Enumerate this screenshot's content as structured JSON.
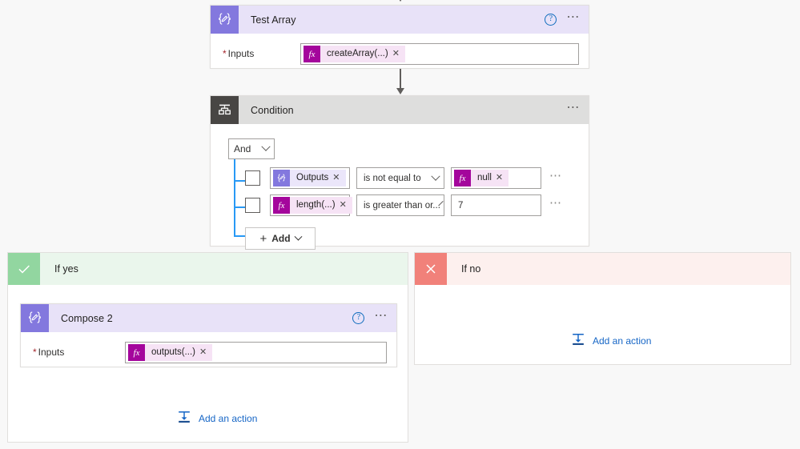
{
  "flow": {
    "compose_top": {
      "title": "Test Array",
      "icon": "compose-braces-icon",
      "help_icon": "help-circle-icon",
      "more_icon": "more-options-icon",
      "field_label": "Inputs",
      "required_marker": "*",
      "token": {
        "badge": "fx",
        "badge_icon": "function-fx-icon",
        "text": "createArray(...)",
        "remove_icon": "remove-token-icon",
        "remove_glyph": "✕"
      }
    },
    "condition": {
      "title": "Condition",
      "icon": "condition-branch-icon",
      "more_icon": "more-options-icon",
      "logical_operator": "And",
      "logical_operator_chevron": "chevron-down-icon",
      "rows": [
        {
          "checkbox_checked": false,
          "operand": {
            "badge_icon": "compose-braces-icon",
            "badge": "{⊘}",
            "text": "Outputs",
            "remove_glyph": "✕",
            "style": "compose"
          },
          "operator": "is not equal to",
          "operator_chevron": "chevron-down-icon",
          "value_token": {
            "badge": "fx",
            "badge_icon": "function-fx-icon",
            "text": "null",
            "remove_glyph": "✕",
            "style": "fx"
          },
          "value_text": "",
          "more_icon": "row-more-options-icon"
        },
        {
          "checkbox_checked": false,
          "operand": {
            "badge": "fx",
            "badge_icon": "function-fx-icon",
            "text": "length(...)",
            "remove_glyph": "✕",
            "style": "fx"
          },
          "operator": "is greater than or...",
          "operator_chevron": "chevron-down-icon",
          "value_token": null,
          "value_text": "7",
          "more_icon": "row-more-options-icon"
        }
      ],
      "add_button": {
        "label": "Add",
        "plus_glyph": "+",
        "plus_icon": "plus-icon",
        "chevron_icon": "chevron-down-icon"
      }
    },
    "branch_yes": {
      "label": "If yes",
      "badge_icon": "checkmark-icon",
      "badge_glyph": "✓",
      "card": {
        "title": "Compose 2",
        "icon": "compose-braces-icon",
        "help_icon": "help-circle-icon",
        "more_icon": "more-options-icon",
        "field_label": "Inputs",
        "required_marker": "*",
        "token": {
          "badge": "fx",
          "badge_icon": "function-fx-icon",
          "text": "outputs(...)",
          "remove_icon": "remove-token-icon",
          "remove_glyph": "✕"
        }
      },
      "add_action": {
        "label": "Add an action",
        "icon": "add-action-insert-icon"
      }
    },
    "branch_no": {
      "label": "If no",
      "badge_icon": "close-x-icon",
      "badge_glyph": "✕",
      "add_action": {
        "label": "Add an action",
        "icon": "add-action-insert-icon"
      }
    },
    "colors": {
      "compose_accent": "#8378de",
      "compose_header": "#e8e2f8",
      "condition_accent": "#484644",
      "condition_header": "#dededd",
      "fx_accent": "#a4069c",
      "fx_chip_bg": "#f6e3f5",
      "yes_accent": "#92d6a0",
      "yes_header": "#eaf6ec",
      "no_accent": "#f1817a",
      "no_header": "#fdf0ee",
      "bracket_blue": "#2899f5",
      "link_blue": "#1666c6",
      "canvas": "#f8f8f8"
    }
  }
}
